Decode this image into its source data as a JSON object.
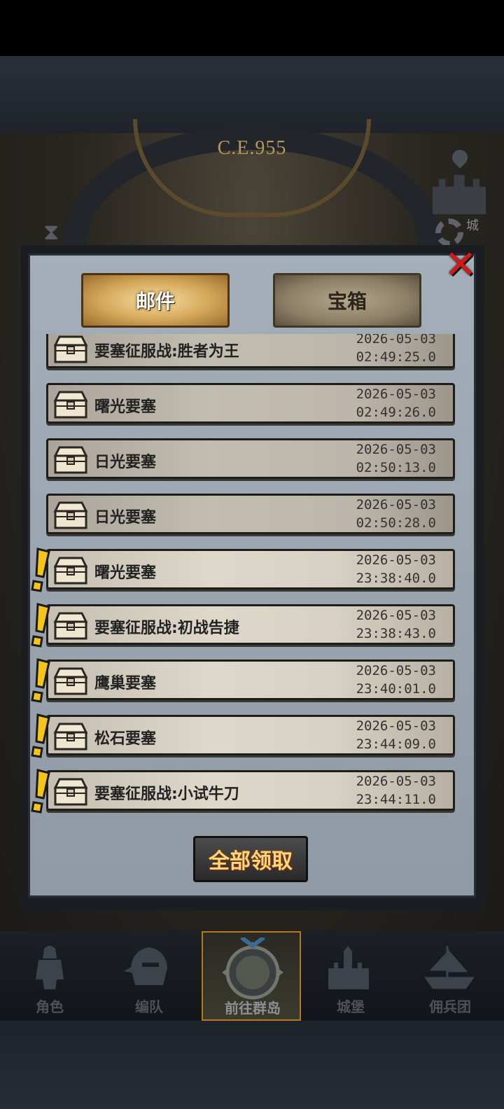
{
  "scene": {
    "era_label": "C.E.955",
    "castle_label": "城"
  },
  "tabs": {
    "mail": "邮件",
    "chest": "宝箱"
  },
  "mail_list": [
    {
      "title": "要塞征服战:胜者为王",
      "date": "2026-05-03",
      "time": "02:49:25.0",
      "unread": false
    },
    {
      "title": "曙光要塞",
      "date": "2026-05-03",
      "time": "02:49:26.0",
      "unread": false
    },
    {
      "title": "日光要塞",
      "date": "2026-05-03",
      "time": "02:50:13.0",
      "unread": false
    },
    {
      "title": "日光要塞",
      "date": "2026-05-03",
      "time": "02:50:28.0",
      "unread": false
    },
    {
      "title": "曙光要塞",
      "date": "2026-05-03",
      "time": "23:38:40.0",
      "unread": true
    },
    {
      "title": "要塞征服战:初战告捷",
      "date": "2026-05-03",
      "time": "23:38:43.0",
      "unread": true
    },
    {
      "title": "鹰巢要塞",
      "date": "2026-05-03",
      "time": "23:40:01.0",
      "unread": true
    },
    {
      "title": "松石要塞",
      "date": "2026-05-03",
      "time": "23:44:09.0",
      "unread": true
    },
    {
      "title": "要塞征服战:小试牛刀",
      "date": "2026-05-03",
      "time": "23:44:11.0",
      "unread": true
    }
  ],
  "claim_all": "全部领取",
  "nav": [
    {
      "label": "角色",
      "icon": "knight-icon",
      "active": false
    },
    {
      "label": "编队",
      "icon": "helmet-icon",
      "active": false
    },
    {
      "label": "前往群岛",
      "icon": "compass-icon",
      "active": true
    },
    {
      "label": "城堡",
      "icon": "castle-icon",
      "active": false
    },
    {
      "label": "佣兵团",
      "icon": "ship-icon",
      "active": false
    }
  ],
  "colors": {
    "accent_gold": "#d4a658",
    "close_red": "#d21818",
    "unread_marker": "#f4c417"
  }
}
